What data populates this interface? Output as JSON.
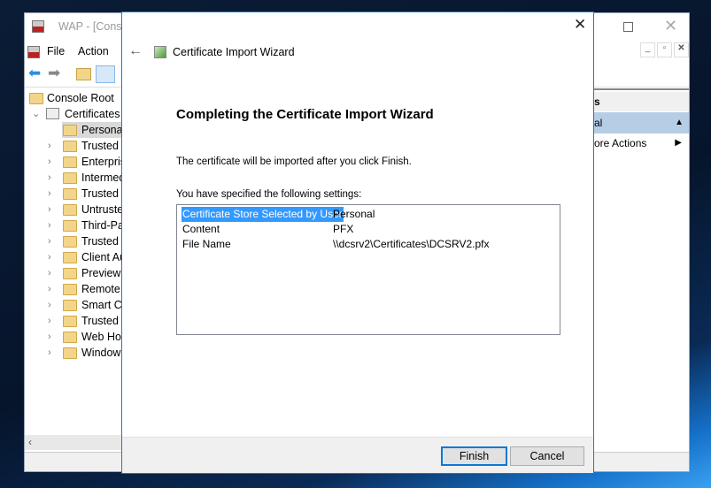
{
  "mmc": {
    "title": "WAP - [Console",
    "menu": [
      "File",
      "Action"
    ],
    "tree": {
      "root": "Console Root",
      "certificates": "Certificates (",
      "children": [
        "Personal",
        "Trusted R",
        "Enterpris",
        "Intermed",
        "Trusted P",
        "Untruste",
        "Third-Pa",
        "Trusted P",
        "Client Au",
        "Preview",
        "Remote",
        "Smart Ca",
        "Trusted D",
        "Web Hos",
        "Window"
      ]
    },
    "actions": {
      "header": "s",
      "selected": "al",
      "more": "ore Actions"
    }
  },
  "dialog": {
    "title": "Certificate Import Wizard",
    "heading": "Completing the Certificate Import Wizard",
    "message": "The certificate will be imported after you click Finish.",
    "settings_label": "You have specified the following settings:",
    "settings": [
      {
        "name": "Certificate Store Selected by User",
        "value": "Personal",
        "selected": true
      },
      {
        "name": "Content",
        "value": "PFX"
      },
      {
        "name": "File Name",
        "value": "\\\\dcsrv2\\Certificates\\DCSRV2.pfx"
      }
    ],
    "finish_label": "Finish",
    "cancel_label": "Cancel"
  },
  "colors": {
    "selection": "#3399ff",
    "accent": "#1a78d0",
    "desktop": "#06152b"
  }
}
